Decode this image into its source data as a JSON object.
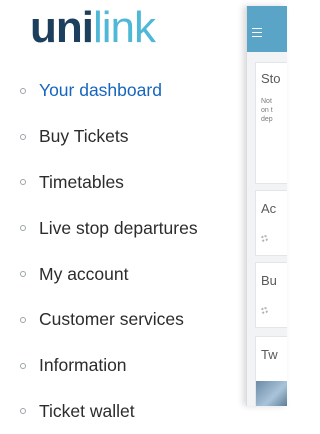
{
  "logo": {
    "part1": "uni",
    "part2": "link"
  },
  "menu": {
    "items": [
      {
        "label": "Your dashboard"
      },
      {
        "label": "Buy Tickets"
      },
      {
        "label": "Timetables"
      },
      {
        "label": "Live stop departures"
      },
      {
        "label": "My account"
      },
      {
        "label": "Customer services"
      },
      {
        "label": "Information"
      },
      {
        "label": "Ticket wallet"
      }
    ]
  },
  "background_panel": {
    "card1_title": "Sto",
    "card1_note": "Not\non t\ndep",
    "card2_title": "Ac",
    "card3_title": "Bu",
    "card4_title": "Tw"
  },
  "colors": {
    "accent": "#1565c0",
    "brand_dark": "#1c3f5e",
    "brand_light": "#4fb8d6",
    "header_bar": "#5aa5c7"
  }
}
